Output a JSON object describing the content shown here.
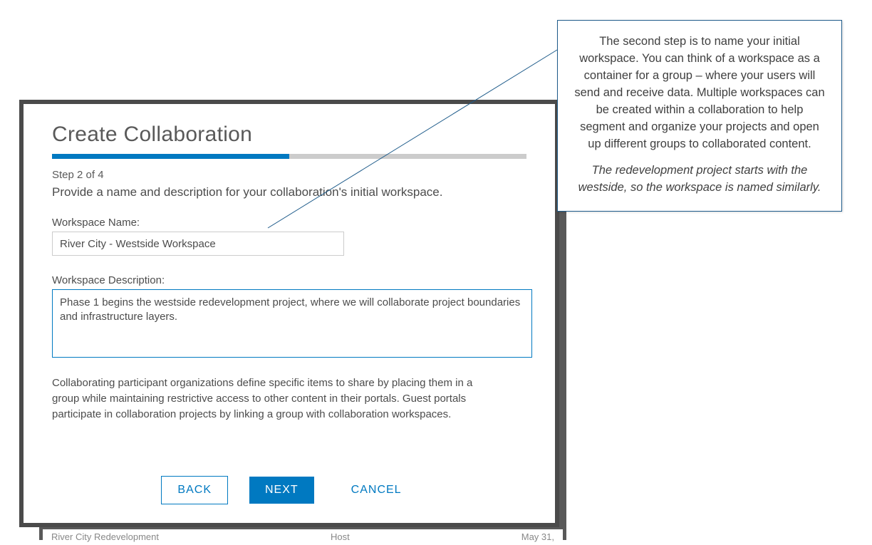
{
  "dialog": {
    "title": "Create Collaboration",
    "step_label": "Step 2 of 4",
    "progress_fill_percent": 50,
    "instruction": "Provide a name and description for your collaboration's initial workspace.",
    "name_label": "Workspace Name:",
    "name_value": "River City - Westside Workspace",
    "desc_label": "Workspace Description:",
    "desc_value": "Phase 1 begins the westside redevelopment project, where we will collaborate project boundaries and infrastructure layers.",
    "help_text": "Collaborating participant organizations define specific items to share by placing them in a group while maintaining restrictive access to other content in their portals. Guest portals participate in collaboration projects by linking a group with collaboration workspaces.",
    "buttons": {
      "back": "BACK",
      "next": "NEXT",
      "cancel": "CANCEL"
    }
  },
  "callout": {
    "p1": "The second step is to name your initial workspace. You can think of a workspace as a container for a group – where your users will send and receive data. Multiple workspaces can be created within a collaboration to help segment and organize your projects and open up different groups to collaborated content.",
    "p2": "The redevelopment project starts with the westside, so the workspace is named similarly."
  },
  "background": {
    "row_left": "River City Redevelopment",
    "row_mid": "Host",
    "row_right": "May 31,"
  }
}
